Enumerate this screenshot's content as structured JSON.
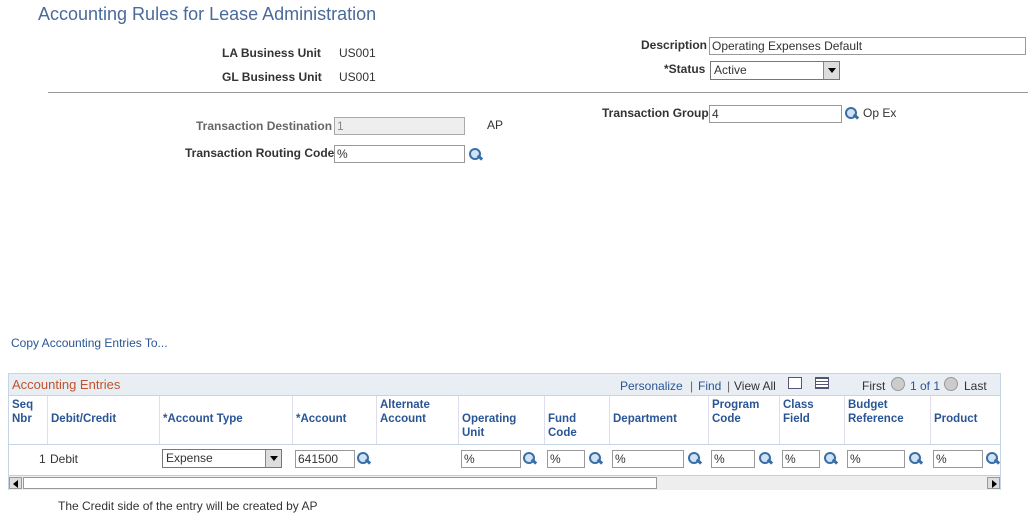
{
  "page": {
    "title": "Accounting Rules for Lease Administration"
  },
  "header": {
    "la_bu_label": "LA Business Unit",
    "la_bu_value": "US001",
    "gl_bu_label": "GL Business Unit",
    "gl_bu_value": "US001",
    "description_label": "Description",
    "description_value": "Operating Expenses Default",
    "status_label": "*Status",
    "status_value": "Active"
  },
  "transaction": {
    "dest_label": "Transaction Destination",
    "dest_value": "1",
    "dest_desc": "AP",
    "routing_label": "Transaction Routing Code",
    "routing_value": "%",
    "group_label": "Transaction Group",
    "group_value": "4",
    "group_desc": "Op Ex"
  },
  "copy_link": "Copy Accounting Entries To...",
  "grid": {
    "title": "Accounting Entries",
    "personalize": "Personalize",
    "find": "Find",
    "sep1": "|",
    "view_all": "View All",
    "sep2": "|",
    "first": "First",
    "count": "1 of 1",
    "last": "Last",
    "columns": [
      "Seq Nbr",
      "Debit/Credit",
      "*Account Type",
      "*Account",
      "Alternate Account",
      "Operating Unit",
      "Fund Code",
      "Department",
      "Program Code",
      "Class Field",
      "Budget Reference",
      "Product"
    ],
    "row": {
      "seq": "1",
      "debit_credit": "Debit",
      "account_type": "Expense",
      "account": "641500",
      "alt_account": "",
      "operating_unit": "%",
      "fund_code": "%",
      "department": "%",
      "program_code": "%",
      "class_field": "%",
      "budget_reference": "%",
      "product": "%"
    }
  },
  "footer_note": "The Credit side of the entry will be created by AP"
}
